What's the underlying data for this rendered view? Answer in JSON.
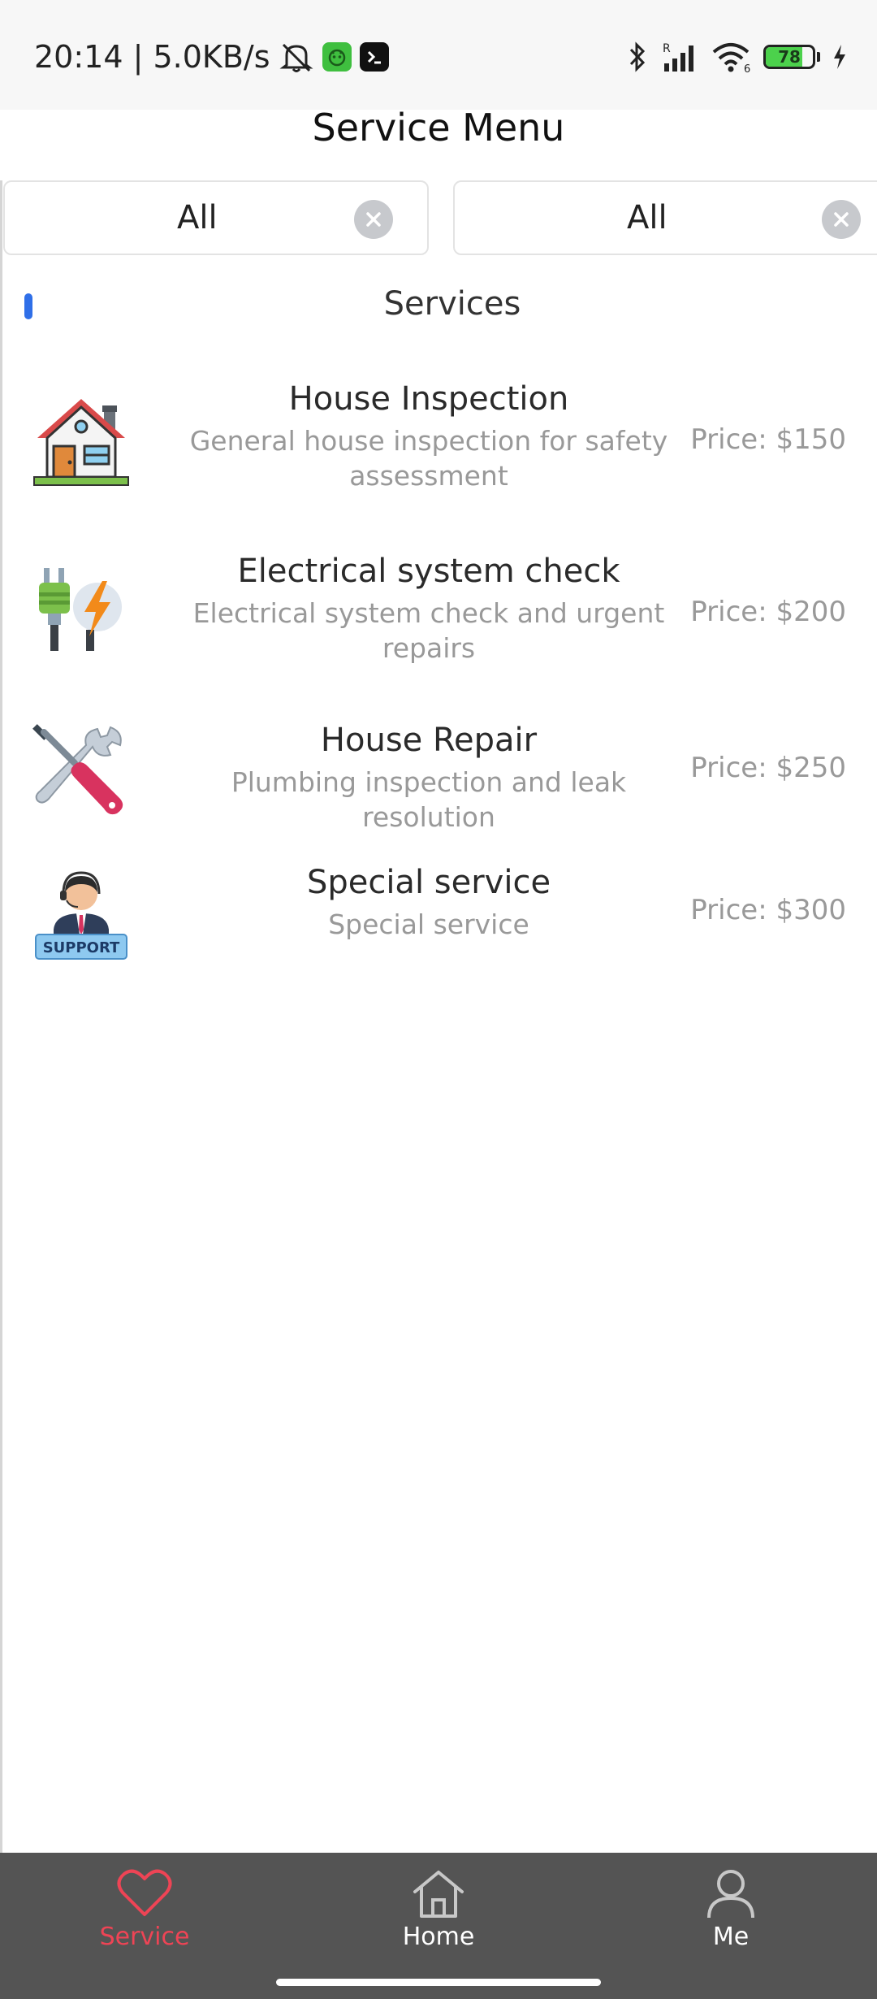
{
  "status_bar": {
    "time_speed": "20:14 | 5.0KB/s",
    "battery_level": "78",
    "battery_fraction": 0.78,
    "icons": [
      "mute-bell-icon",
      "app-notification-icon",
      "terminal-icon",
      "bluetooth-icon",
      "signal-icon",
      "wifi-icon",
      "battery-icon",
      "charging-icon"
    ],
    "signal_letter": "R",
    "wifi_badge": "6"
  },
  "header": {
    "title": "Service Menu"
  },
  "filters": [
    {
      "value": "All",
      "clear_icon": "clear-icon"
    },
    {
      "value": "All",
      "clear_icon": "clear-icon"
    }
  ],
  "section": {
    "title": "Services",
    "accent_color": "#2f6fe8"
  },
  "services": [
    {
      "name": "House Inspection",
      "description": "General house inspection for safety assessment",
      "price": "Price: $150",
      "icon": "house-icon"
    },
    {
      "name": "Electrical system check",
      "description": "Electrical system check and urgent repairs",
      "price": "Price: $200",
      "icon": "plug-lightning-icon"
    },
    {
      "name": "House Repair",
      "description": "Plumbing inspection and leak resolution",
      "price": "Price: $250",
      "icon": "tools-icon"
    },
    {
      "name": "Special service",
      "description": "Special service",
      "price": "Price: $300",
      "icon": "support-agent-icon",
      "icon_text": "SUPPORT"
    }
  ],
  "bottom_nav": {
    "items": [
      {
        "label": "Service",
        "icon": "heart-icon",
        "active": true
      },
      {
        "label": "Home",
        "icon": "home-icon",
        "active": false
      },
      {
        "label": "Me",
        "icon": "person-icon",
        "active": false
      }
    ],
    "active_color": "#ee4455",
    "background": "#545454"
  }
}
